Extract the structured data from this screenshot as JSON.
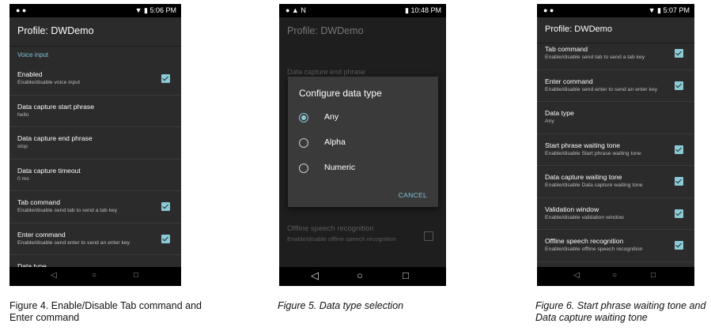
{
  "phone1": {
    "status": {
      "left": "● ●",
      "right": "▼ ▮ 5:06 PM"
    },
    "title": "Profile: DWDemo",
    "section": "Voice input",
    "items": [
      {
        "title": "Enabled",
        "sub": "Enable/disable voice input",
        "checked": true
      },
      {
        "title": "Data capture start phrase",
        "sub": "hello",
        "checked": false
      },
      {
        "title": "Data capture end phrase",
        "sub": "stop",
        "checked": false
      },
      {
        "title": "Data capture timeout",
        "sub": "0 ms",
        "checked": false
      },
      {
        "title": "Tab command",
        "sub": "Enable/disable send tab to send a tab key",
        "checked": true
      },
      {
        "title": "Enter command",
        "sub": "Enable/disable send enter to send an enter key",
        "checked": true
      },
      {
        "title": "Data type",
        "sub": "",
        "checked": false
      }
    ],
    "nav": {
      "back": "◁",
      "home": "○",
      "recent": "□"
    },
    "caption": "Figure 4. Enable/Disable Tab command and Enter command"
  },
  "phone2": {
    "status": {
      "left": "● ▲ N",
      "right": "▮ 10:48 PM"
    },
    "title": "Profile: DWDemo",
    "bg_item": "Data capture end phrase",
    "bg_offline_title": "Offline speech recognition",
    "bg_offline_sub": "Enable/disable offline speech recognition",
    "dialog": {
      "title": "Configure data type",
      "options": [
        "Any",
        "Alpha",
        "Numeric"
      ],
      "selected": "Any",
      "cancel": "CANCEL"
    },
    "nav": {
      "back": "◁",
      "home": "○",
      "recent": "□"
    },
    "caption": "Figure 5. Data type selection"
  },
  "phone3": {
    "status": {
      "left": "● ●",
      "right": "▼ ▮ 5:07 PM"
    },
    "title": "Profile: DWDemo",
    "items": [
      {
        "title": "Tab command",
        "sub": "Enable/disable send tab to send a tab key",
        "checked": true
      },
      {
        "title": "Enter command",
        "sub": "Enable/disable send enter to send an enter key",
        "checked": true
      },
      {
        "title": "Data type",
        "sub": "Any",
        "checked": false
      },
      {
        "title": "Start phrase waiting tone",
        "sub": "Enable/disable Start phrase waiting tone",
        "checked": true
      },
      {
        "title": "Data capture waiting tone",
        "sub": "Enable/disable Data capture waiting tone",
        "checked": true
      },
      {
        "title": "Validation window",
        "sub": "Enable/disable validation window",
        "checked": true
      },
      {
        "title": "Offline speech recognition",
        "sub": "Enable/disable offline speech recognition",
        "checked": true
      }
    ],
    "nav": {
      "back": "◁",
      "home": "○",
      "recent": "□"
    },
    "caption": "Figure 6. Start phrase waiting tone and Data capture waiting tone"
  }
}
